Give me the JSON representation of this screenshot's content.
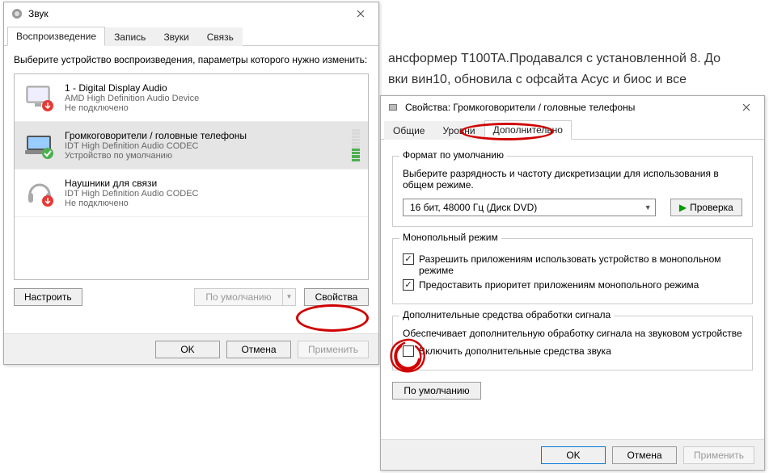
{
  "background": {
    "line1": "ансформер T100TA.Продавался с установленной 8. До",
    "line2": "вки вин10, обновила с офсайта Асус и биос и все"
  },
  "sound_window": {
    "title": "Звук",
    "tabs": [
      "Воспроизведение",
      "Запись",
      "Звуки",
      "Связь"
    ],
    "active_tab": 0,
    "instruction": "Выберите устройство воспроизведения, параметры которого нужно изменить:",
    "devices": [
      {
        "name": "1 - Digital Display Audio",
        "driver": "AMD High Definition Audio Device",
        "status": "Не подключено",
        "icon": "monitor",
        "selected": false
      },
      {
        "name": "Громкоговорители / головные телефоны",
        "driver": "IDT High Definition Audio CODEC",
        "status": "Устройство по умолчанию",
        "icon": "laptop-speaker",
        "selected": true
      },
      {
        "name": "Наушники для связи",
        "driver": "IDT High Definition Audio CODEC",
        "status": "Не подключено",
        "icon": "headphones",
        "selected": false
      }
    ],
    "configure_btn": "Настроить",
    "default_btn": "По умолчанию",
    "properties_btn": "Свойства",
    "ok_btn": "OK",
    "cancel_btn": "Отмена",
    "apply_btn": "Применить"
  },
  "props_window": {
    "title": "Свойства: Громкоговорители / головные телефоны",
    "tabs": [
      "Общие",
      "Уровни",
      "Дополнительно"
    ],
    "active_tab": 2,
    "format_group": {
      "legend": "Формат по умолчанию",
      "desc": "Выберите разрядность и частоту дискретизации для использования в общем режиме.",
      "selected": "16 бит, 48000 Гц (Диск DVD)",
      "test_btn": "Проверка"
    },
    "exclusive_group": {
      "legend": "Монопольный режим",
      "opt1": "Разрешить приложениям использовать устройство в монопольном режиме",
      "opt2": "Предоставить приоритет приложениям монопольного режима"
    },
    "enhance_group": {
      "legend": "Дополнительные средства обработки сигнала",
      "desc": "Обеспечивает дополнительную обработку сигнала на звуковом устройстве",
      "opt": "Включить дополнительные средства звука"
    },
    "restore_btn": "По умолчанию",
    "ok_btn": "OK",
    "cancel_btn": "Отмена",
    "apply_btn": "Применить"
  }
}
